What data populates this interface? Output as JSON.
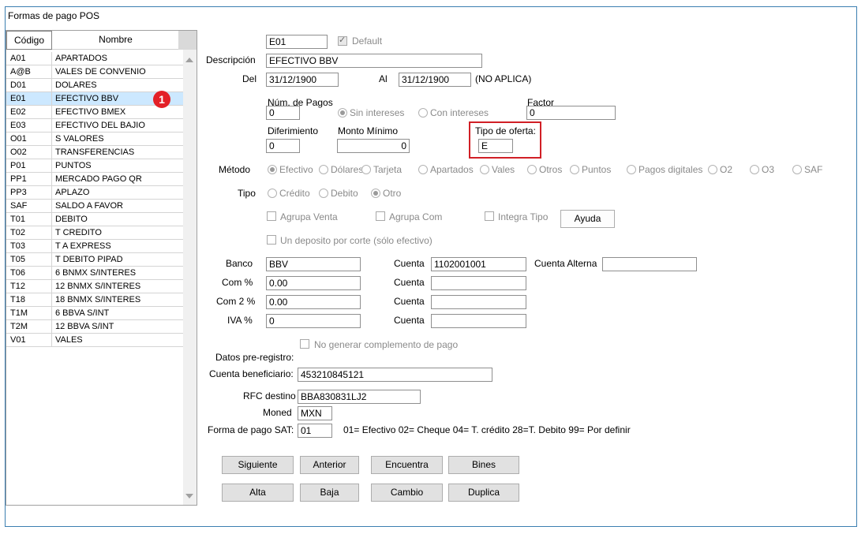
{
  "window": {
    "title": "Formas de pago POS"
  },
  "list": {
    "headers": {
      "code": "Código",
      "name": "Nombre"
    },
    "rows": [
      {
        "code": "A01",
        "name": "APARTADOS"
      },
      {
        "code": "A@B",
        "name": "VALES DE CONVENIO"
      },
      {
        "code": "D01",
        "name": "DOLARES"
      },
      {
        "code": "E01",
        "name": "EFECTIVO BBV"
      },
      {
        "code": "E02",
        "name": "EFECTIVO BMEX"
      },
      {
        "code": "E03",
        "name": "EFECTIVO DEL BAJIO"
      },
      {
        "code": "O01",
        "name": "S VALORES"
      },
      {
        "code": "O02",
        "name": "TRANSFERENCIAS"
      },
      {
        "code": "P01",
        "name": "PUNTOS"
      },
      {
        "code": "PP1",
        "name": "MERCADO PAGO QR"
      },
      {
        "code": "PP3",
        "name": "APLAZO"
      },
      {
        "code": "SAF",
        "name": "SALDO A FAVOR"
      },
      {
        "code": "T01",
        "name": "DEBITO"
      },
      {
        "code": "T02",
        "name": "T CREDITO"
      },
      {
        "code": "T03",
        "name": "T A EXPRESS"
      },
      {
        "code": "T05",
        "name": "T DEBITO PIPAD"
      },
      {
        "code": "T06",
        "name": "6 BNMX S/INTERES"
      },
      {
        "code": "T12",
        "name": "12 BNMX S/INTERES"
      },
      {
        "code": "T18",
        "name": "18 BNMX S/INTERES"
      },
      {
        "code": "T1M",
        "name": "6 BBVA  S/INT"
      },
      {
        "code": "T2M",
        "name": "12 BBVA S/INT"
      },
      {
        "code": "V01",
        "name": "VALES"
      }
    ],
    "selected_index": 3,
    "badge": "1"
  },
  "form": {
    "code": "E01",
    "default_label": "Default",
    "descripcion_label": "Descripción",
    "descripcion": "EFECTIVO BBV",
    "del_label": "Del",
    "del_value": "31/12/1900",
    "al_label": "Al",
    "al_value": "31/12/1900",
    "no_aplica": "(NO APLICA)",
    "num_pagos_label": "Núm. de Pagos",
    "num_pagos": "0",
    "sin_intereses": "Sin intereses",
    "con_intereses": "Con intereses",
    "factor_label": "Factor",
    "factor": "0",
    "diferimiento_label": "Diferimiento",
    "diferimiento": "0",
    "monto_minimo_label": "Monto Mínimo",
    "monto_minimo": "0",
    "tipo_oferta_label": "Tipo de oferta:",
    "tipo_oferta": "E",
    "metodo_label": "Método",
    "metodos": [
      "Efectivo",
      "Dólares",
      "Tarjeta",
      "Apartados",
      "Vales",
      "Otros",
      "Puntos",
      "Pagos digitales",
      "O2",
      "O3",
      "SAF"
    ],
    "tipo_label": "Tipo",
    "tipos": [
      "Crédito",
      "Debito",
      "Otro"
    ],
    "agrupa_venta": "Agrupa Venta",
    "agrupa_com": "Agrupa Com",
    "integra_tipo": "Integra Tipo",
    "ayuda": "Ayuda",
    "deposito_corte": "Un deposito por corte (sólo efectivo)",
    "banco_label": "Banco",
    "banco": "BBV",
    "cuenta_label": "Cuenta",
    "cuenta1": "1102001001",
    "cuenta_alterna_label": "Cuenta Alterna",
    "com_label": "Com %",
    "com": "0.00",
    "com2_label": "Com 2 %",
    "com2": "0.00",
    "iva_label": "IVA %",
    "iva": "0",
    "no_generar": "No generar complemento de pago",
    "datos_pre": "Datos pre-registro:",
    "cuenta_benef_label": "Cuenta beneficiario:",
    "cuenta_benef": "453210845121",
    "rfc_label": "RFC destino",
    "rfc": "BBA830831LJ2",
    "moned_label": "Moned",
    "moned": "MXN",
    "forma_sat_label": "Forma de pago SAT:",
    "forma_sat": "01",
    "forma_sat_help": "01= Efectivo  02= Cheque  04= T. crédito  28=T. Debito  99= Por definir"
  },
  "buttons": {
    "siguiente": "Siguiente",
    "anterior": "Anterior",
    "encuentra": "Encuentra",
    "bines": "Bines",
    "alta": "Alta",
    "baja": "Baja",
    "cambio": "Cambio",
    "duplica": "Duplica"
  }
}
